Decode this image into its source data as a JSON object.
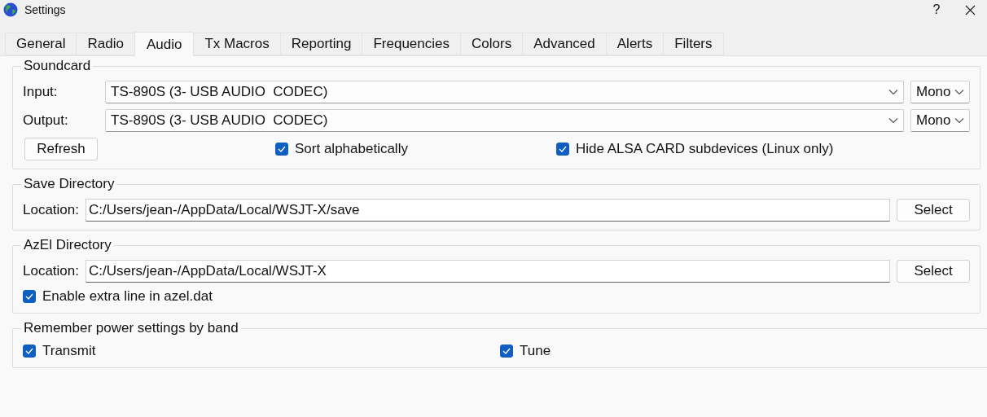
{
  "window": {
    "title": "Settings",
    "help": "?"
  },
  "tabs": [
    {
      "label": "General",
      "selected": false
    },
    {
      "label": "Radio",
      "selected": false
    },
    {
      "label": "Audio",
      "selected": true
    },
    {
      "label": "Tx Macros",
      "selected": false
    },
    {
      "label": "Reporting",
      "selected": false
    },
    {
      "label": "Frequencies",
      "selected": false
    },
    {
      "label": "Colors",
      "selected": false
    },
    {
      "label": "Advanced",
      "selected": false
    },
    {
      "label": "Alerts",
      "selected": false
    },
    {
      "label": "Filters",
      "selected": false
    }
  ],
  "soundcard": {
    "title": "Soundcard",
    "devices": [
      {
        "label": "Input:",
        "value": "TS-890S (3- USB AUDIO  CODEC)",
        "channels": "Mono"
      },
      {
        "label": "Output:",
        "value": "TS-890S (3- USB AUDIO  CODEC)",
        "channels": "Mono"
      }
    ],
    "refresh_button": "Refresh",
    "checkboxes": [
      {
        "label": "Sort alphabetically",
        "checked": true
      },
      {
        "label": "Hide ALSA CARD subdevices (Linux only)",
        "checked": true
      }
    ]
  },
  "save_directory": {
    "title": "Save Directory",
    "label": "Location:",
    "value": "C:/Users/jean-/AppData/Local/WSJT-X/save",
    "button": "Select"
  },
  "azel_directory": {
    "title": "AzEl Directory",
    "label": "Location:",
    "value": "C:/Users/jean-/AppData/Local/WSJT-X",
    "button": "Select",
    "checkbox": {
      "label": "Enable extra line in azel.dat",
      "checked": true
    }
  },
  "power_settings": {
    "title": "Remember power settings by band",
    "checkboxes": [
      {
        "label": "Transmit",
        "checked": true
      },
      {
        "label": "Tune",
        "checked": true
      }
    ]
  }
}
